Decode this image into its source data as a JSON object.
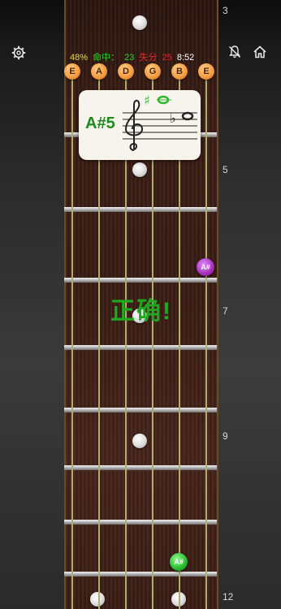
{
  "stats": {
    "accuracy": "48%",
    "hits_label": "命中：",
    "hits": "23",
    "miss_label": "失分",
    "misses": "25",
    "timer": "8:52"
  },
  "toolbar": {
    "settings_icon": "gear-icon",
    "mute_icon": "notification-off-icon",
    "home_icon": "home-icon"
  },
  "open_strings": [
    "E",
    "A",
    "D",
    "G",
    "B",
    "E"
  ],
  "question": {
    "note": "A#5",
    "staff_sharp": "♯",
    "staff_flat": "♭"
  },
  "fret_numbers": [
    "3",
    "5",
    "7",
    "9",
    "12"
  ],
  "markers": [
    {
      "label": "A#",
      "color": "#a52fb8"
    },
    {
      "label": "A#",
      "color": "#29b82f"
    }
  ],
  "feedback": "正确!",
  "colors": {
    "accuracy": "#e6d84a",
    "hits": "#2fd42f",
    "misses": "#e02a2a",
    "timer": "#ffffff",
    "open_string": "#f29a3c",
    "correct": "#1fa81f"
  }
}
